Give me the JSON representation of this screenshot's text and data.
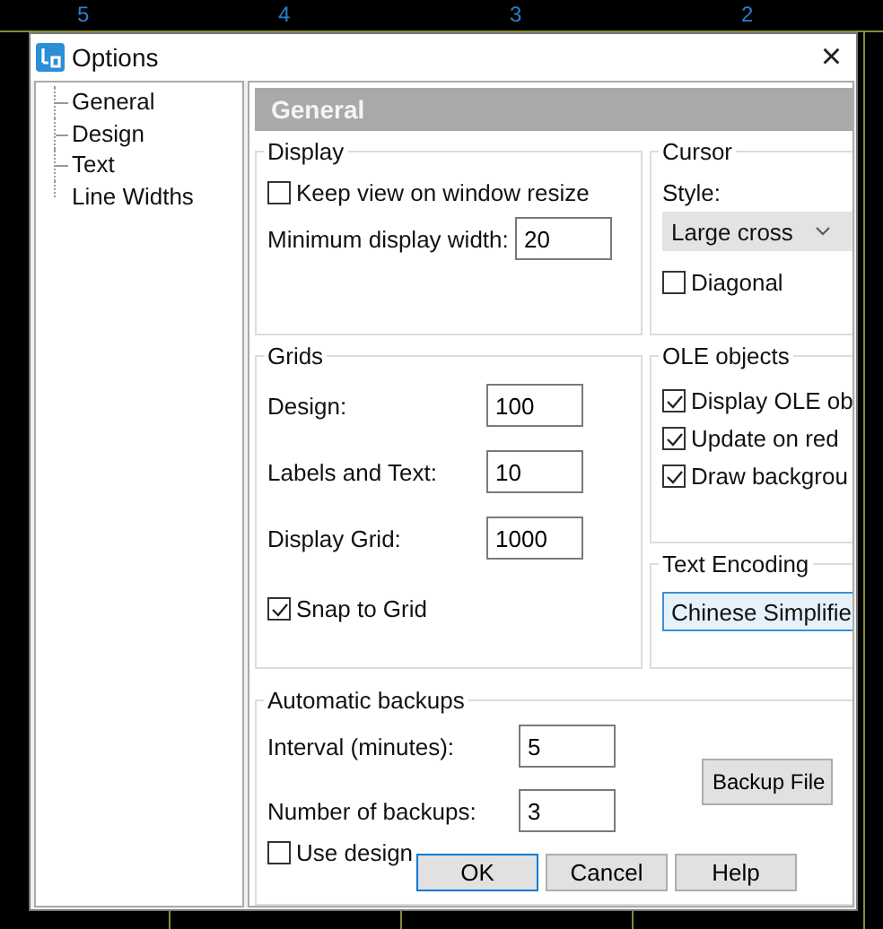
{
  "canvas": {
    "column_labels": [
      "5",
      "4",
      "3",
      "2"
    ]
  },
  "window": {
    "title": "Options",
    "close": "×"
  },
  "tree": {
    "items": [
      {
        "label": "General"
      },
      {
        "label": "Design"
      },
      {
        "label": "Text"
      },
      {
        "label": "Line Widths"
      }
    ]
  },
  "page_header": "General",
  "display": {
    "title": "Display",
    "keep_view": {
      "label": "Keep view on window resize",
      "checked": false
    },
    "min_width": {
      "label": "Minimum display width:",
      "value": "20"
    }
  },
  "cursor": {
    "title": "Cursor",
    "style_label": "Style:",
    "style_value": "Large cross",
    "diagonal": {
      "label": "Diagonal",
      "checked": false
    }
  },
  "grids": {
    "title": "Grids",
    "fields": [
      {
        "label": "Design:",
        "value": "100"
      },
      {
        "label": "Labels and Text:",
        "value": "10"
      },
      {
        "label": "Display Grid:",
        "value": "1000"
      }
    ],
    "snap": {
      "label": "Snap to Grid",
      "checked": true
    }
  },
  "ole": {
    "title": "OLE objects",
    "options": [
      {
        "label": "Display OLE ob",
        "checked": true
      },
      {
        "label": "Update on red",
        "checked": true
      },
      {
        "label": "Draw backgrou",
        "checked": true
      }
    ]
  },
  "encoding": {
    "title": "Text Encoding",
    "value": "Chinese Simplifie"
  },
  "backups": {
    "title": "Automatic backups",
    "fields": [
      {
        "label": "Interval (minutes):",
        "value": "5"
      },
      {
        "label": "Number of backups:",
        "value": "3"
      }
    ],
    "use_design": {
      "label": "Use design",
      "checked": false
    },
    "file_button": "Backup File"
  },
  "buttons": [
    {
      "label": "OK",
      "focused": true
    },
    {
      "label": "Cancel",
      "focused": false
    },
    {
      "label": "Help",
      "focused": false
    }
  ]
}
